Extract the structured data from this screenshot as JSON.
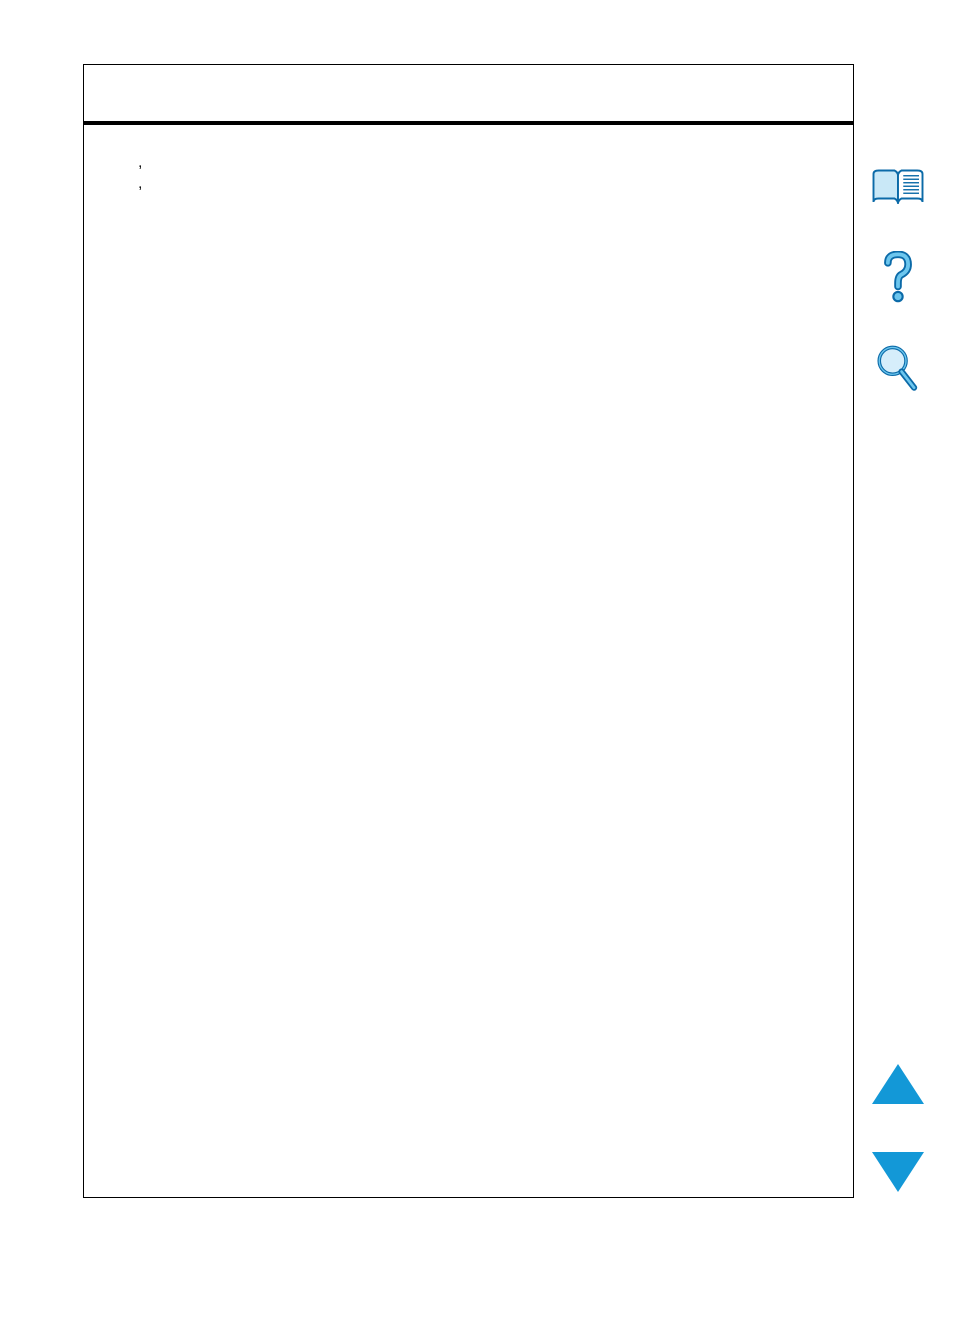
{
  "content": {
    "line1_prefix": "",
    "line1_comma": ",",
    "line2_prefix": "",
    "line2_comma": ","
  },
  "sidebar": {
    "toc_icon_name": "book-icon",
    "help_icon_name": "question-icon",
    "search_icon_name": "magnifier-icon"
  },
  "nav": {
    "up_name": "page-up",
    "down_name": "page-down"
  }
}
